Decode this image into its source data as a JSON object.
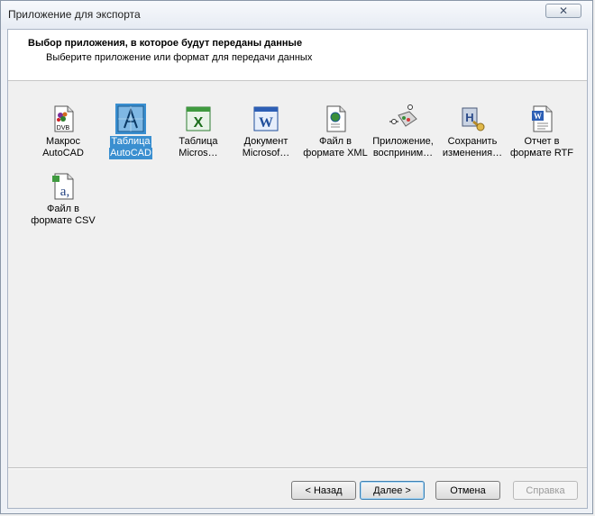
{
  "window": {
    "title": "Приложение для экспорта",
    "close_label": "✕"
  },
  "header": {
    "title": "Выбор приложения, в которое будут переданы данные",
    "subtitle": "Выберите приложение или формат для передачи данных"
  },
  "items": [
    {
      "line1": "Макрос",
      "line2": "AutoCAD",
      "icon": "dvb-macro-icon",
      "selected": false
    },
    {
      "line1": "Таблица",
      "line2": "AutoCAD",
      "icon": "autocad-table-icon",
      "selected": true
    },
    {
      "line1": "Таблица",
      "line2": "Micros…",
      "icon": "excel-icon",
      "selected": false
    },
    {
      "line1": "Документ",
      "line2": "Microsof…",
      "icon": "word-icon",
      "selected": false
    },
    {
      "line1": "Файл в",
      "line2": "формате XML",
      "icon": "xml-file-icon",
      "selected": false
    },
    {
      "line1": "Приложение,",
      "line2": "восприним…",
      "icon": "app-receiver-icon",
      "selected": false
    },
    {
      "line1": "Сохранить",
      "line2": "изменения…",
      "icon": "save-changes-icon",
      "selected": false
    },
    {
      "line1": "Отчет в",
      "line2": "формате RTF",
      "icon": "rtf-report-icon",
      "selected": false
    },
    {
      "line1": "Файл в",
      "line2": "формате CSV",
      "icon": "csv-file-icon",
      "selected": false
    }
  ],
  "buttons": {
    "back": "< Назад",
    "next": "Далее >",
    "cancel": "Отмена",
    "help": "Справка"
  }
}
